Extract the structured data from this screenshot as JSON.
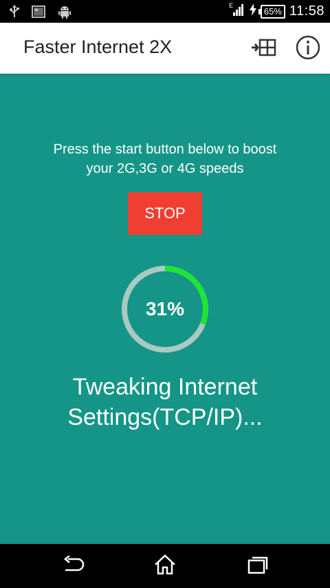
{
  "status_bar": {
    "battery": "65%",
    "time": "11:58",
    "signal_label": "E"
  },
  "app_bar": {
    "title": "Faster Internet 2X"
  },
  "main": {
    "prompt_line1": "Press the start button below to boost",
    "prompt_line2": "your 2G,3G or 4G speeds",
    "button_label": "STOP",
    "progress": {
      "percent": 31,
      "label": "31%"
    },
    "status_line1": "Tweaking Internet",
    "status_line2": "Settings(TCP/IP)..."
  },
  "colors": {
    "background": "#149587",
    "button": "#ef3f32",
    "progress_track": "#a9c9c2",
    "progress_fill": "#1ee534"
  },
  "icons": {
    "status_left": [
      "usb-icon",
      "image-icon",
      "android-icon"
    ],
    "status_right": [
      "signal-icon",
      "charging-icon"
    ],
    "app_actions": [
      "expand-icon",
      "info-icon"
    ],
    "navigation": [
      "back-icon",
      "home-icon",
      "recent-apps-icon"
    ]
  }
}
